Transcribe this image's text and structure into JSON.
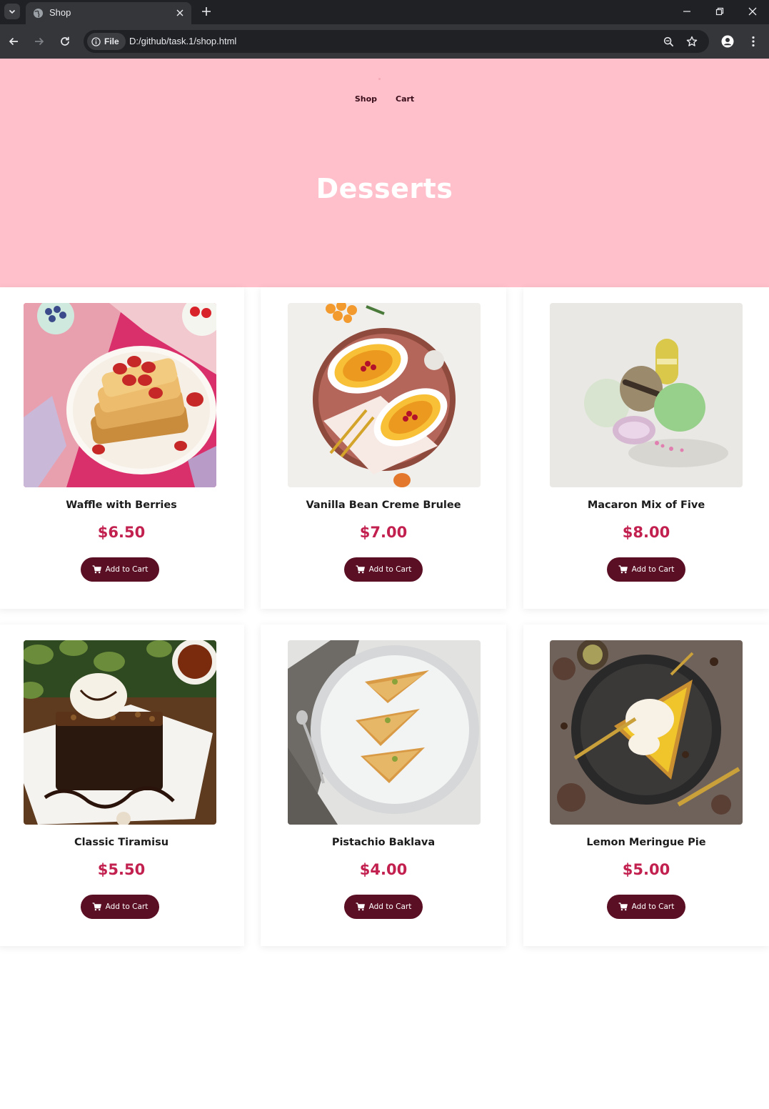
{
  "browser": {
    "tab_title": "Shop",
    "site_chip_label": "File",
    "url": "D:/github/task.1/shop.html"
  },
  "site": {
    "nav": [
      {
        "label": "Shop"
      },
      {
        "label": "Cart"
      }
    ],
    "hero_title": "Desserts",
    "colors": {
      "hero_bg": "#ffc0cb",
      "price": "#c2204f",
      "button": "#5a0f24"
    }
  },
  "products": [
    {
      "name": "Waffle with Berries",
      "price": "$6.50",
      "button_label": "Add to Cart",
      "image": "waffle-with-berries"
    },
    {
      "name": "Vanilla Bean Creme Brulee",
      "price": "$7.00",
      "button_label": "Add to Cart",
      "image": "creme-brulee"
    },
    {
      "name": "Macaron Mix of Five",
      "price": "$8.00",
      "button_label": "Add to Cart",
      "image": "macarons"
    },
    {
      "name": "Classic Tiramisu",
      "price": "$5.50",
      "button_label": "Add to Cart",
      "image": "brownie-with-ice-cream"
    },
    {
      "name": "Pistachio Baklava",
      "price": "$4.00",
      "button_label": "Add to Cart",
      "image": "baklava"
    },
    {
      "name": "Lemon Meringue Pie",
      "price": "$5.00",
      "button_label": "Add to Cart",
      "image": "lemon-meringue-pie"
    }
  ]
}
